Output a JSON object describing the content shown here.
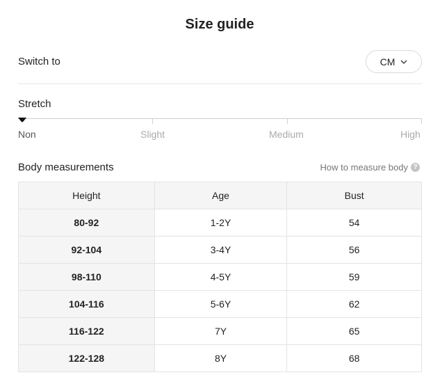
{
  "title": "Size guide",
  "switch": {
    "label": "Switch to",
    "unit": "CM"
  },
  "stretch": {
    "label": "Stretch",
    "levels": [
      "Non",
      "Slight",
      "Medium",
      "High"
    ],
    "selected": "Non"
  },
  "body_measurements": {
    "title": "Body measurements",
    "how_to_link": "How to measure body",
    "columns": [
      "Height",
      "Age",
      "Bust"
    ],
    "rows": [
      [
        "80-92",
        "1-2Y",
        "54"
      ],
      [
        "92-104",
        "3-4Y",
        "56"
      ],
      [
        "98-110",
        "4-5Y",
        "59"
      ],
      [
        "104-116",
        "5-6Y",
        "62"
      ],
      [
        "116-122",
        "7Y",
        "65"
      ],
      [
        "122-128",
        "8Y",
        "68"
      ]
    ]
  },
  "icons": {
    "chevron": "chevron-down-icon",
    "help": "question-icon",
    "marker": "slider-marker-icon"
  },
  "colors": {
    "text": "#222222",
    "muted": "#aaaaaa",
    "table_header_bg": "#f5f5f5",
    "border": "#e3e3e3"
  }
}
